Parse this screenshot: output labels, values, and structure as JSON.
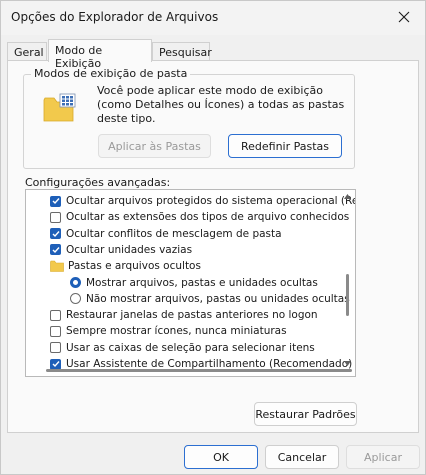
{
  "window": {
    "title": "Opções do Explorador de Arquivos"
  },
  "tabs": [
    {
      "label": "Geral"
    },
    {
      "label": "Modo de Exibição"
    },
    {
      "label": "Pesquisar"
    }
  ],
  "folder_views": {
    "legend": "Modos de exibição de pasta",
    "description": "Você pode aplicar este modo de exibição (como Detalhes ou Ícones) a todas as pastas deste tipo.",
    "apply_button": "Aplicar às Pastas",
    "reset_button": "Redefinir Pastas"
  },
  "advanced": {
    "label": "Configurações avançadas:",
    "items": [
      {
        "type": "checkbox",
        "checked": true,
        "indent": 0,
        "label": "Ocultar arquivos protegidos do sistema operacional (Reco"
      },
      {
        "type": "checkbox",
        "checked": false,
        "indent": 0,
        "label": "Ocultar as extensões dos tipos de arquivo conhecidos"
      },
      {
        "type": "checkbox",
        "checked": true,
        "indent": 0,
        "label": "Ocultar conflitos de mesclagem de pasta"
      },
      {
        "type": "checkbox",
        "checked": true,
        "indent": 0,
        "label": "Ocultar unidades vazias"
      },
      {
        "type": "folder",
        "checked": false,
        "indent": 0,
        "label": "Pastas e arquivos ocultos"
      },
      {
        "type": "radio",
        "checked": true,
        "indent": 1,
        "label": "Mostrar arquivos, pastas e unidades ocultas"
      },
      {
        "type": "radio",
        "checked": false,
        "indent": 1,
        "label": "Não mostrar arquivos, pastas ou unidades ocultas"
      },
      {
        "type": "checkbox",
        "checked": false,
        "indent": 0,
        "label": "Restaurar janelas de pastas anteriores no logon"
      },
      {
        "type": "checkbox",
        "checked": false,
        "indent": 0,
        "label": "Sempre mostrar ícones, nunca miniaturas"
      },
      {
        "type": "checkbox",
        "checked": false,
        "indent": 0,
        "label": "Usar as caixas de seleção para selecionar itens"
      },
      {
        "type": "checkbox",
        "checked": true,
        "indent": 0,
        "label": "Usar Assistente de Compartilhamento (Recomendado)"
      }
    ]
  },
  "restore_defaults_button": "Restaurar Padrões",
  "footer": {
    "ok": "OK",
    "cancel": "Cancelar",
    "apply": "Aplicar"
  },
  "colors": {
    "accent": "#1e5fb8",
    "folder_yellow": "#f2c94c"
  }
}
